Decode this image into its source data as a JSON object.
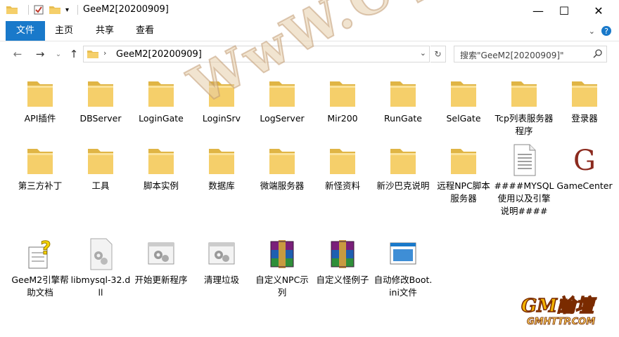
{
  "window": {
    "title": "GeeM2[20200909]",
    "controls": {
      "minimize": "—",
      "maximize": "☐",
      "close": "✕"
    }
  },
  "ribbon": {
    "tabs": [
      "文件",
      "主页",
      "共享",
      "查看"
    ],
    "active_tab_color": "#1979ca"
  },
  "nav": {
    "back_icon": "arrow-left-icon",
    "forward_icon": "arrow-right-icon",
    "up_icon": "arrow-up-icon",
    "path_text": "GeeM2[20200909]",
    "search_placeholder": "搜索\"GeeM2[20200909]\""
  },
  "items": [
    {
      "label": "API插件",
      "type": "folder"
    },
    {
      "label": "DBServer",
      "type": "folder"
    },
    {
      "label": "LoginGate",
      "type": "folder"
    },
    {
      "label": "LoginSrv",
      "type": "folder"
    },
    {
      "label": "LogServer",
      "type": "folder"
    },
    {
      "label": "Mir200",
      "type": "folder"
    },
    {
      "label": "RunGate",
      "type": "folder"
    },
    {
      "label": "SelGate",
      "type": "folder"
    },
    {
      "label": "Tcp列表服务器程序",
      "type": "folder"
    },
    {
      "label": "登录器",
      "type": "folder"
    },
    {
      "label": "第三方补丁",
      "type": "folder"
    },
    {
      "label": "工具",
      "type": "folder"
    },
    {
      "label": "脚本实例",
      "type": "folder"
    },
    {
      "label": "数据库",
      "type": "folder"
    },
    {
      "label": "微端服务器",
      "type": "folder"
    },
    {
      "label": "新怪资料",
      "type": "folder"
    },
    {
      "label": "新沙巴克说明",
      "type": "folder"
    },
    {
      "label": "远程NPC脚本服务器",
      "type": "folder"
    },
    {
      "label": "####MYSQL使用以及引擎说明####",
      "type": "text"
    },
    {
      "label": "GameCenter",
      "type": "app"
    },
    {
      "label": "GeeM2引擎帮助文档",
      "type": "help"
    },
    {
      "label": "libmysql-32.dll",
      "type": "dll"
    },
    {
      "label": "开始更新程序",
      "type": "batch"
    },
    {
      "label": "清理垃圾",
      "type": "batch"
    },
    {
      "label": "自定义NPC示列",
      "type": "rar"
    },
    {
      "label": "自定义怪例子",
      "type": "rar"
    },
    {
      "label": "自动修改Boot.ini文件",
      "type": "exe"
    }
  ],
  "watermark": {
    "text": "WwW.CqSYBB.Com",
    "logo_top": "GM論壇",
    "logo_bottom": "GMHTTP.COM"
  },
  "colors": {
    "folder_front": "#f5cf6a",
    "folder_back": "#e0b545",
    "accent": "#1979ca"
  }
}
